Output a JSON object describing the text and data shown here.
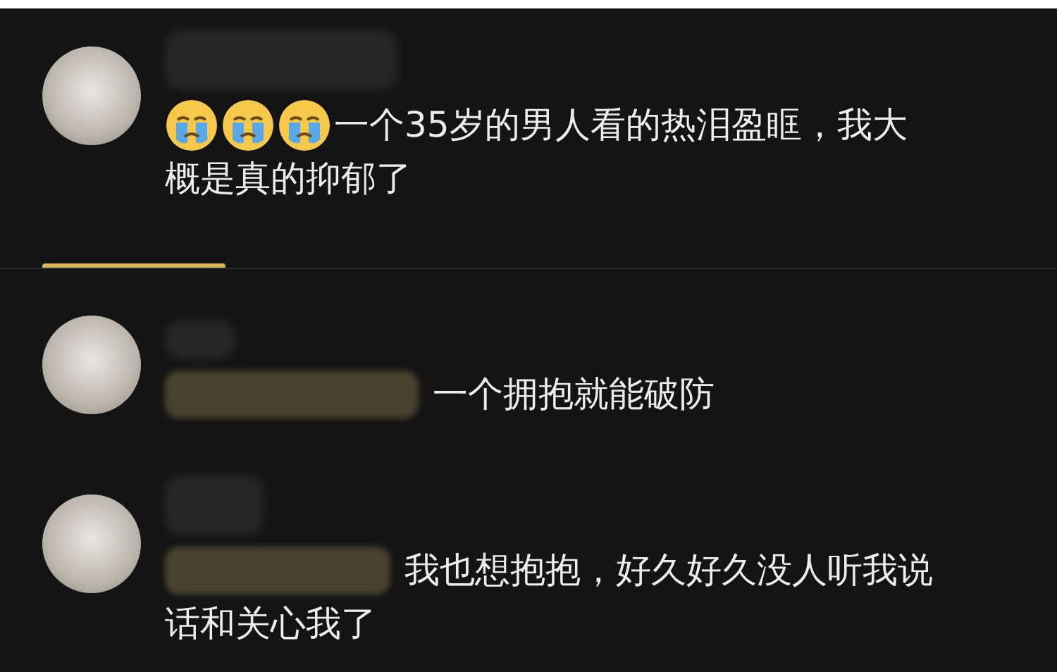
{
  "comments": [
    {
      "name_hidden": true,
      "parts": [
        {
          "kind": "emoji"
        },
        {
          "kind": "emoji"
        },
        {
          "kind": "emoji"
        }
      ],
      "lines": [
        "一个35岁的男人看的热泪盈眶，我大",
        "概是真的抑郁了"
      ]
    },
    {
      "name_hidden": true,
      "parts": [
        {
          "kind": "redacted"
        }
      ],
      "lines": [
        "一个拥抱就能破防"
      ]
    },
    {
      "name_hidden": true,
      "parts": [
        {
          "kind": "redacted"
        }
      ],
      "lines": [
        "我也想抱抱，好久好久没人听我说",
        "话和关心我了"
      ]
    }
  ]
}
